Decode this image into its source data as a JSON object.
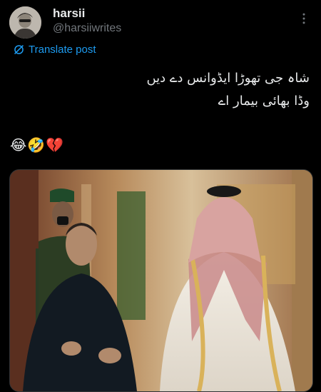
{
  "author": {
    "display_name": "harsii",
    "handle": "@harsiiwrites"
  },
  "post": {
    "translate_label": "Translate post",
    "text_lines": [
      "شاہ جی تھوڑا ایڈوانس دے دیں",
      "وڈا بھائی بیمار اے"
    ],
    "emojis": "😂🤣💔"
  },
  "icons": {
    "more": "more-horizontal-icon",
    "translate": "translate-icon"
  },
  "colors": {
    "background": "#000000",
    "text_primary": "#e7e9ea",
    "text_secondary": "#71767b",
    "link_accent": "#1d9bf0"
  }
}
